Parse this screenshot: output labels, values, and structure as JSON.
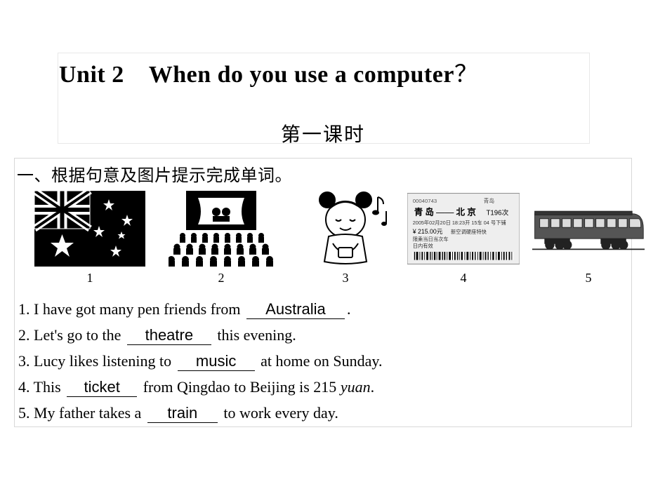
{
  "unit_label": "Unit 2",
  "unit_question": "When do you use a computer",
  "qmark": "？",
  "subtitle": "第一课时",
  "section_title": "一、根据句意及图片提示完成单词。",
  "images": {
    "n1": "1",
    "n2": "2",
    "n3": "3",
    "n4": "4",
    "n5": "5"
  },
  "sentences": {
    "s1a": "1. I have got many pen friends from ",
    "s1b": ".",
    "s2a": "2. Let's go to the ",
    "s2b": " this evening.",
    "s3a": "3. Lucy likes listening to ",
    "s3b": " at home on Sunday.",
    "s4a": "4. This ",
    "s4b": " from Qingdao to Beijing is 215 ",
    "s4c": "yuan",
    "s4d": ".",
    "s5a": "5. My father takes a ",
    "s5b": " to work every day."
  },
  "answers": {
    "a1": "Australia",
    "a2": "theatre",
    "a3": "music",
    "a4": "ticket",
    "a5": "train"
  }
}
